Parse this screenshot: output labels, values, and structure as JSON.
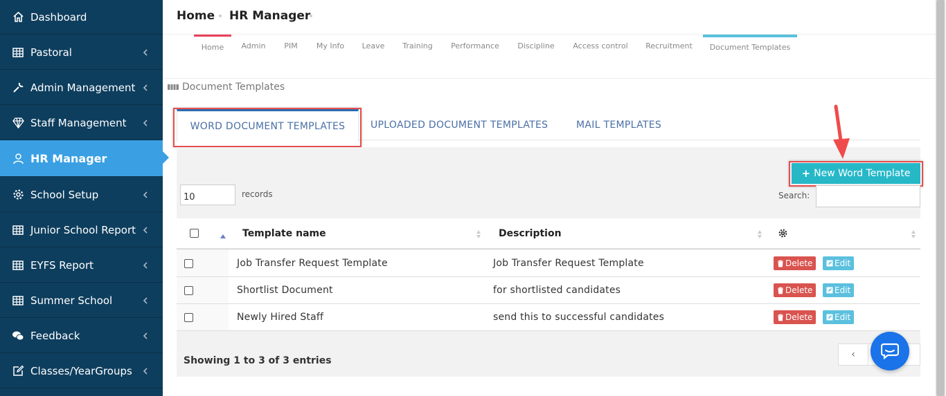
{
  "sidebar": {
    "items": [
      {
        "label": "Dashboard",
        "icon": "home-icon",
        "chevron": false
      },
      {
        "label": "Pastoral",
        "icon": "table-icon",
        "chevron": true
      },
      {
        "label": "Admin Management",
        "icon": "wrench-icon",
        "chevron": true
      },
      {
        "label": "Staff Management",
        "icon": "diamond-icon",
        "chevron": true
      },
      {
        "label": "HR Manager",
        "icon": "user-icon",
        "chevron": false,
        "active": true
      },
      {
        "label": "School Setup",
        "icon": "gear-icon",
        "chevron": true
      },
      {
        "label": "Junior School Report",
        "icon": "table-icon",
        "chevron": true
      },
      {
        "label": "EYFS Report",
        "icon": "table-icon",
        "chevron": true
      },
      {
        "label": "Summer School",
        "icon": "table-icon",
        "chevron": true
      },
      {
        "label": "Feedback",
        "icon": "chat-bubbles-icon",
        "chevron": true
      },
      {
        "label": "Classes/YearGroups",
        "icon": "edit-icon",
        "chevron": true
      }
    ]
  },
  "breadcrumb": {
    "home": "Home",
    "current": "HR Manager"
  },
  "nav_tabs": [
    {
      "label": "Home",
      "active_color": "#e8405a"
    },
    {
      "label": "Admin"
    },
    {
      "label": "PIM"
    },
    {
      "label": "My Info"
    },
    {
      "label": "Leave"
    },
    {
      "label": "Training"
    },
    {
      "label": "Performance"
    },
    {
      "label": "Discipline"
    },
    {
      "label": "Access control"
    },
    {
      "label": "Recruitment"
    },
    {
      "label": "Document Templates",
      "active_color": "#5bc0de"
    }
  ],
  "section_title": "Document Templates",
  "doc_tabs": [
    {
      "label": "WORD DOCUMENT TEMPLATES",
      "active": true
    },
    {
      "label": "UPLOADED DOCUMENT TEMPLATES"
    },
    {
      "label": "MAIL TEMPLATES"
    }
  ],
  "toolbar": {
    "new_label": "New Word Template"
  },
  "length": {
    "value": "10",
    "label": "records"
  },
  "search": {
    "label": "Search:",
    "value": ""
  },
  "table": {
    "headers": {
      "name": "Template name",
      "description": "Description"
    },
    "rows": [
      {
        "name": "Job Transfer Request Template",
        "description": "Job Transfer Request Template"
      },
      {
        "name": "Shortlist Document",
        "description": "for shortlisted candidates"
      },
      {
        "name": "Newly Hired Staff",
        "description": "send this to successful candidates"
      }
    ],
    "delete_label": "Delete",
    "edit_label": "Edit"
  },
  "footer": {
    "showing": "Showing 1 to 3 of 3 entries",
    "prev": "‹"
  },
  "colors": {
    "sidebar": "#0e3e5e",
    "active": "#3aa0e3",
    "accent": "#27b8c8",
    "danger": "#d9534f",
    "info": "#5bc0de",
    "highlight": "#e84d4d"
  }
}
